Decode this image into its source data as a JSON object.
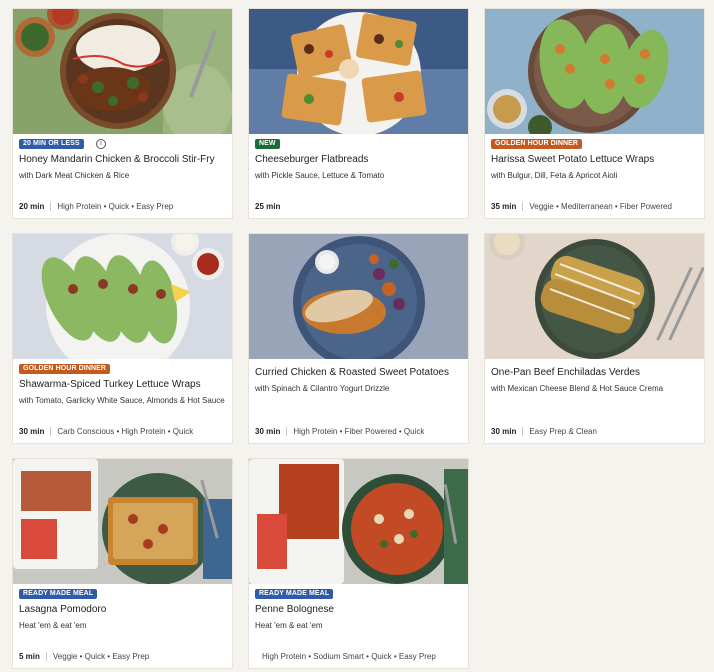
{
  "colors": {
    "badge_blue": "#2f5ba8",
    "badge_green": "#1f6b35",
    "badge_orange": "#c55a1f",
    "page_bg": "#f5f3ee"
  },
  "cards": [
    {
      "badge": "20 MIN OR LESS",
      "badge_color": "#2f5ba8",
      "info_icon": "info-icon",
      "title": "Honey Mandarin Chicken & Broccoli Stir-Fry",
      "subtitle": "with Dark Meat Chicken & Rice",
      "time": "20 min",
      "tags": "High Protein • Quick • Easy Prep"
    },
    {
      "badge": "NEW",
      "badge_color": "#1f6b35",
      "title": "Cheeseburger Flatbreads",
      "subtitle": "with Pickle Sauce, Lettuce & Tomato",
      "time": "25 min",
      "tags": ""
    },
    {
      "badge": "GOLDEN HOUR DINNER",
      "badge_color": "#c55a1f",
      "title": "Harissa Sweet Potato Lettuce Wraps",
      "subtitle": "with Bulgur, Dill, Feta & Apricot Aioli",
      "time": "35 min",
      "tags": "Veggie • Mediterranean • Fiber Powered"
    },
    {
      "badge": "GOLDEN HOUR DINNER",
      "badge_color": "#c55a1f",
      "title": "Shawarma-Spiced Turkey Lettuce Wraps",
      "subtitle": "with Tomato, Garlicky White Sauce, Almonds & Hot Sauce",
      "time": "30 min",
      "tags": "Carb Conscious • High Protein • Quick"
    },
    {
      "badge": "",
      "badge_color": "",
      "title": "Curried Chicken & Roasted Sweet Potatoes",
      "subtitle": "with Spinach & Cilantro Yogurt Drizzle",
      "time": "30 min",
      "tags": "High Protein • Fiber Powered • Quick"
    },
    {
      "badge": "",
      "badge_color": "",
      "title": "One-Pan Beef Enchiladas Verdes",
      "subtitle": "with Mexican Cheese Blend & Hot Sauce Crema",
      "time": "30 min",
      "tags": "Easy Prep & Clean"
    },
    {
      "badge": "READY MADE MEAL",
      "badge_color": "#2f5ba8",
      "title": "Lasagna Pomodoro",
      "subtitle": "Heat 'em & eat 'em",
      "time": "5 min",
      "tags": "Veggie • Quick • Easy Prep"
    },
    {
      "badge": "READY MADE MEAL",
      "badge_color": "#2f5ba8",
      "title": "Penne Bolognese",
      "subtitle": "Heat 'em & eat 'em",
      "time": "",
      "tags": "High Protein • Sodium Smart • Quick • Easy Prep"
    }
  ]
}
